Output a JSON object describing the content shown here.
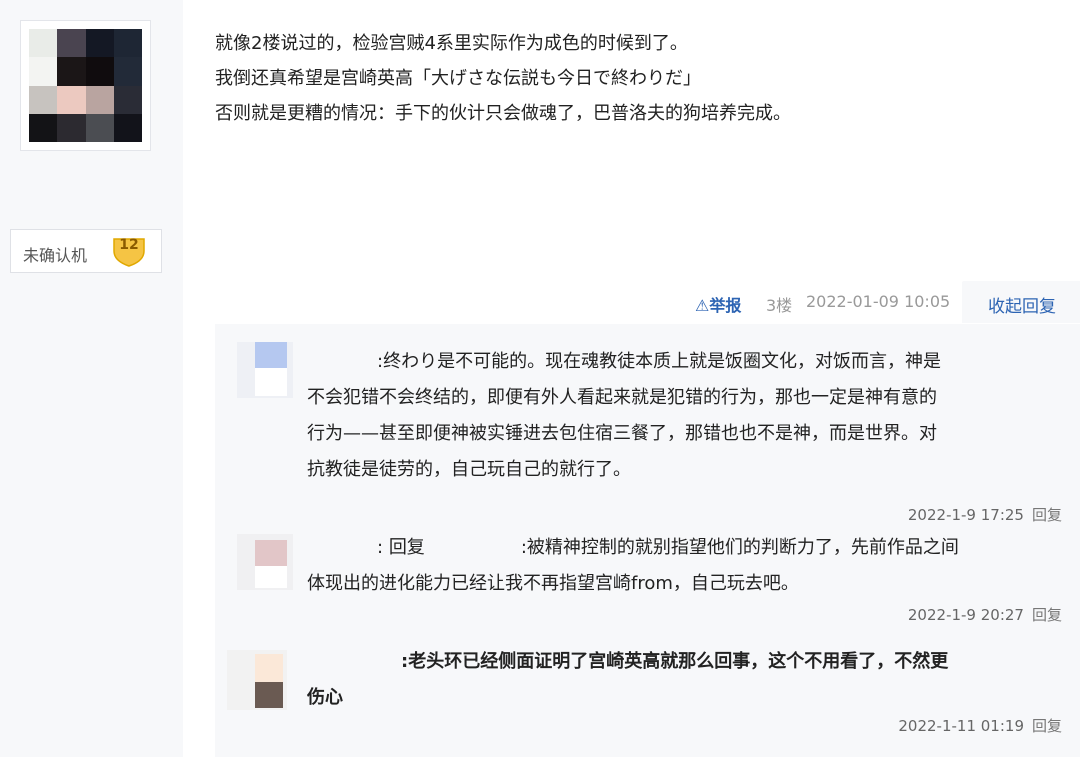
{
  "author": {
    "level_label": "未确认机",
    "level_number": "12"
  },
  "post": {
    "lines": [
      "就像2楼说过的，检验宫贼4系里实际作为成色的时候到了。",
      "我倒还真希望是宫崎英高「大げさな伝説も今日で終わりだ」",
      "否则就是更糟的情况：手下的伙计只会做魂了，巴普洛夫的狗培养完成。"
    ],
    "report_label": "⚠举报",
    "floor": "3楼",
    "time": "2022-01-09 10:05",
    "collapse_label": "收起回复"
  },
  "replies": [
    {
      "lines": [
        ":终わり是不可能的。现在魂教徒本质上就是饭圈文化，对饭而言，神是",
        "不会犯错不会终结的，即便有外人看起来就是犯错的行为，那也一定是神有意的",
        "行为——甚至即便神被实锤进去包住宿三餐了，那错也也不是神，而是世界。对",
        "抗教徒是徒劳的，自己玩自己的就行了。"
      ],
      "time": "2022-1-9 17:25",
      "reply_label": "回复"
    },
    {
      "prefix": ":",
      "reply_word": "回复",
      "first_line_rest": ":被精神控制的就别指望他们的判断力了，先前作品之间",
      "lines": [
        "体现出的进化能力已经让我不再指望宫崎from，自己玩去吧。"
      ],
      "time": "2022-1-9 20:27",
      "reply_label": "回复"
    },
    {
      "lines": [
        ":老头环已经侧面证明了宫崎英高就那么回事，这个不用看了，不然更",
        "伤心"
      ],
      "time": "2022-1-11 01:19",
      "reply_label": "回复"
    }
  ],
  "colors": {
    "link": "#2d64b3",
    "panel_bg": "#f7f8fa",
    "badge": "#f5c444"
  }
}
